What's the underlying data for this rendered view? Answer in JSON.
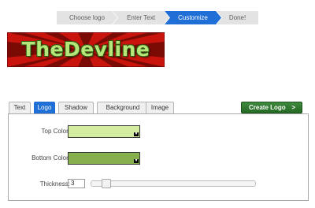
{
  "wizard": {
    "steps": [
      {
        "label": "Choose logo",
        "state": "done"
      },
      {
        "label": "Enter Text",
        "state": "done"
      },
      {
        "label": "Customize",
        "state": "active"
      },
      {
        "label": "Done!",
        "state": "pending"
      }
    ]
  },
  "logo": {
    "text": "TheDevline",
    "text_color": "#b5e67a",
    "background": "red-sunburst"
  },
  "tabs": [
    {
      "label": "Text",
      "active": false
    },
    {
      "label": "Logo",
      "active": true
    },
    {
      "label": "Shadow",
      "active": false
    },
    {
      "label": "Background",
      "active": false
    },
    {
      "label": "Image",
      "active": false
    }
  ],
  "create_button": {
    "label": "Create Logo",
    "arrow": ">"
  },
  "logo_panel": {
    "top_color": {
      "label": "Top Color:",
      "value": "#d3ec9f"
    },
    "bottom_color": {
      "label": "Bottom Color:",
      "value": "#86b04d"
    },
    "thickness": {
      "label": "Thickness:",
      "value": "3",
      "slider_fraction": 0.07
    }
  },
  "colors": {
    "accent": "#1f6fd6",
    "create_button": "#2d7a2d"
  }
}
